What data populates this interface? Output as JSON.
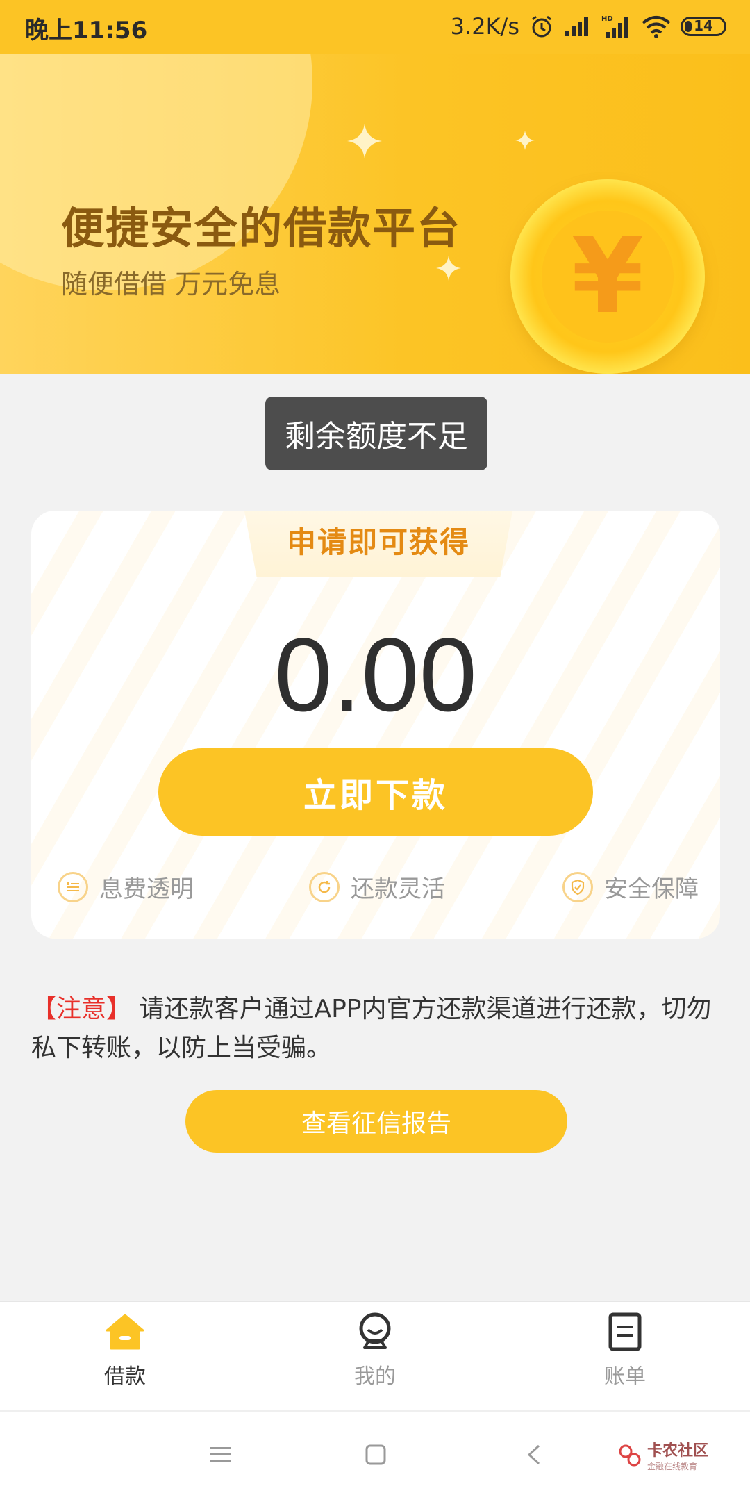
{
  "status_bar": {
    "time": "晚上11:56",
    "speed": "3.2K/s",
    "battery": "14",
    "icons": [
      "alarm-icon",
      "signal-icon",
      "hd-signal-icon",
      "wifi-icon",
      "battery-icon"
    ]
  },
  "hero": {
    "title": "便捷安全的借款平台",
    "subtitle": "随便借借 万元免息",
    "coin_symbol": "¥"
  },
  "toast": {
    "text": "剩余额度不足"
  },
  "card": {
    "tab_label": "申请即可获得",
    "amount": "0.00",
    "primary_button": "立即下款",
    "features": [
      {
        "label": "息费透明",
        "icon": "list-icon"
      },
      {
        "label": "还款灵活",
        "icon": "refresh-icon"
      },
      {
        "label": "安全保障",
        "icon": "shield-icon"
      }
    ]
  },
  "notice": {
    "tag": "【注意】",
    "text": " 请还款客户通过APP内官方还款渠道进行还款，切勿私下转账，以防上当受骗。"
  },
  "secondary_button": "查看征信报告",
  "bottom_nav": {
    "items": [
      {
        "label": "借款",
        "icon": "home-icon",
        "active": true
      },
      {
        "label": "我的",
        "icon": "user-icon",
        "active": false
      },
      {
        "label": "账单",
        "icon": "bill-icon",
        "active": false
      }
    ]
  },
  "system_nav": {
    "icons": [
      "menu-icon",
      "home-square-icon",
      "back-icon"
    ]
  },
  "watermark": {
    "name": "卡农社区",
    "tagline": "金融在线教育"
  },
  "colors": {
    "accent": "#fcc425",
    "title_brown": "#8a5a10",
    "notice_red": "#e8302a",
    "toast_bg": "#4d4d4d"
  }
}
